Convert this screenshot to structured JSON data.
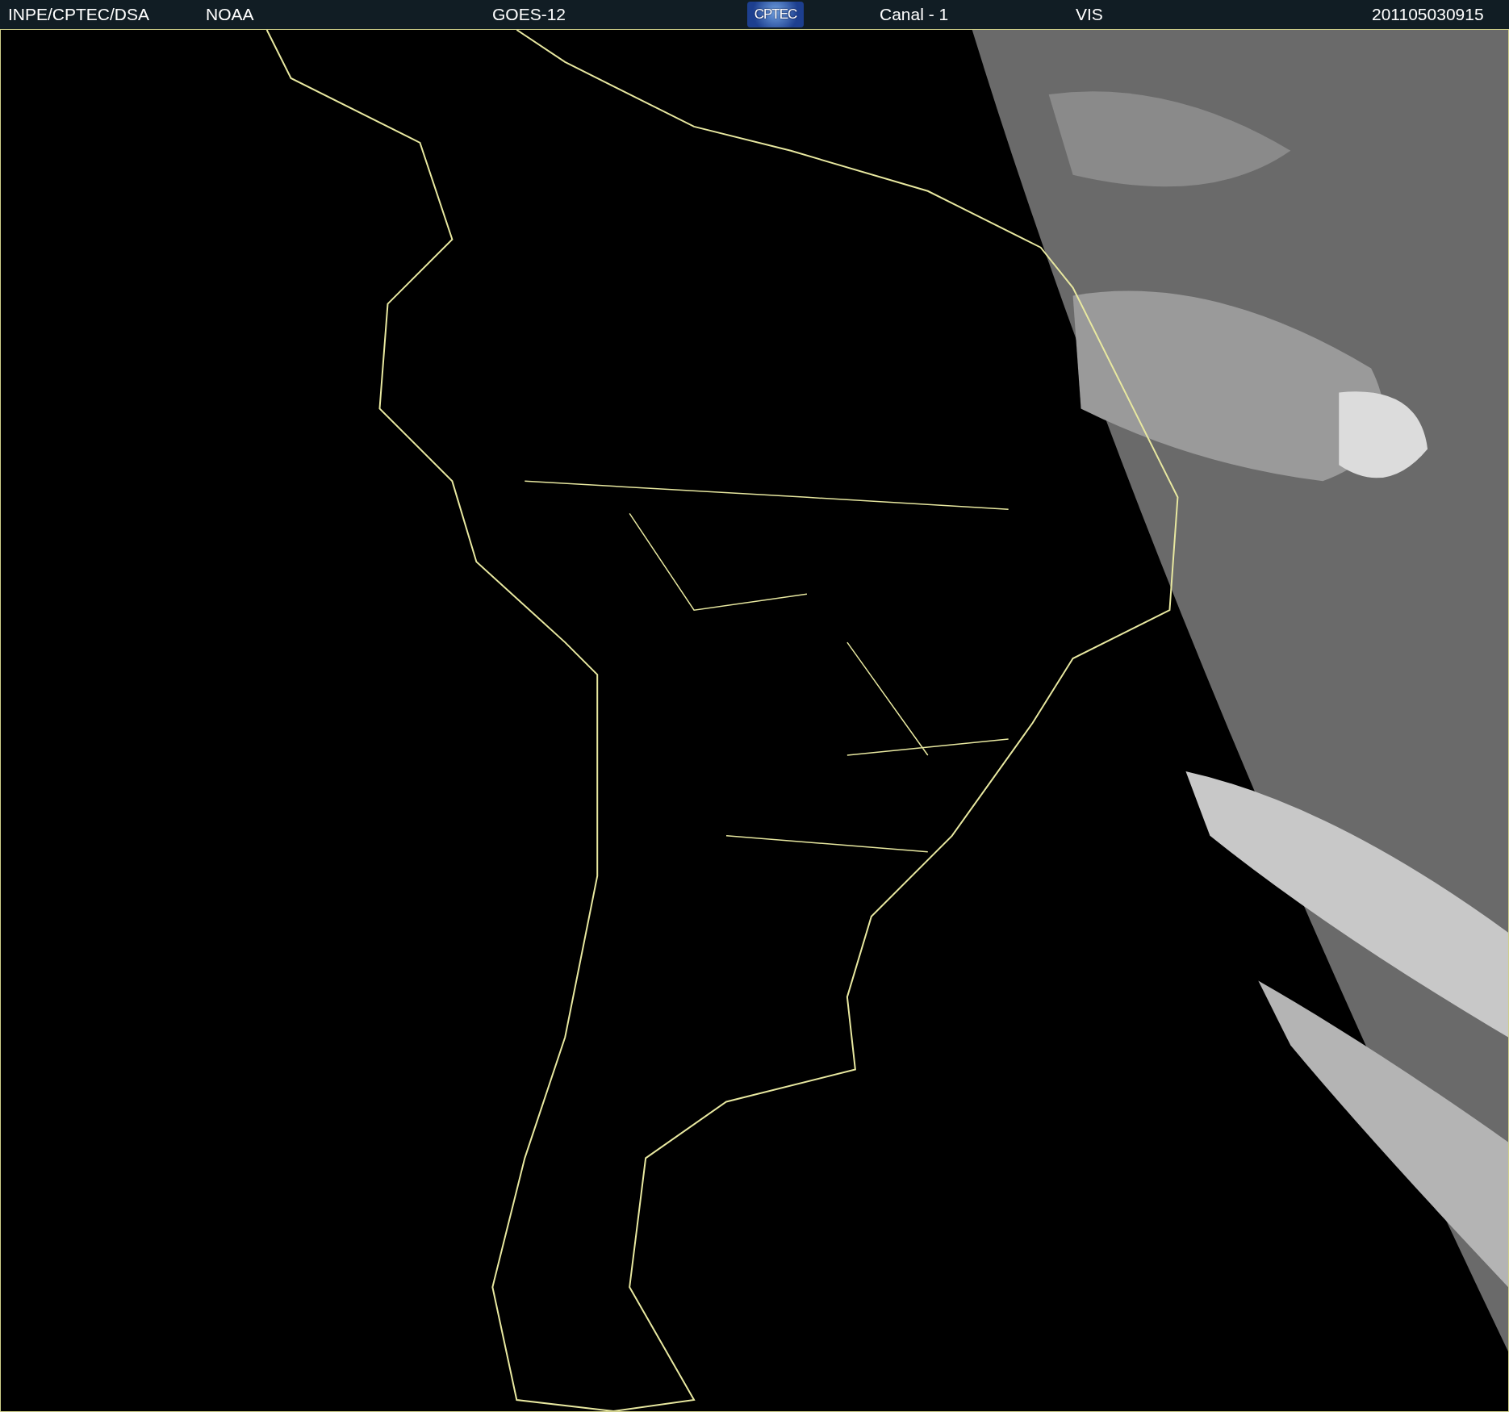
{
  "header": {
    "source": "INPE/CPTEC/DSA",
    "agency": "NOAA",
    "satellite": "GOES-12",
    "logo": "CPTEC",
    "channel": "Canal - 1",
    "band": "VIS",
    "timestamp": "201105030915"
  }
}
